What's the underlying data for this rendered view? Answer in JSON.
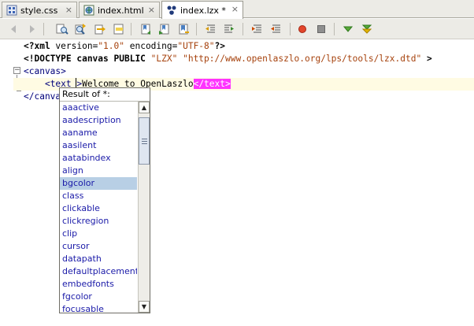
{
  "tabs": [
    {
      "label": "style.css",
      "icon": "css-file-icon",
      "active": false
    },
    {
      "label": "index.html",
      "icon": "html-file-icon",
      "active": false
    },
    {
      "label": "index.lzx *",
      "icon": "lzx-file-icon",
      "active": true
    }
  ],
  "tab_close_glyph": "×",
  "toolbar": {
    "buttons": [
      "back-icon",
      "forward-icon",
      "find-selection-icon",
      "find-previous-icon",
      "find-next-icon",
      "toggle-highlight-icon",
      "previous-bookmark-icon",
      "next-bookmark-icon",
      "toggle-bookmark-icon",
      "shift-left-icon",
      "shift-right-icon",
      "comment-icon",
      "uncomment-icon",
      "start-macro-icon",
      "stop-macro-icon",
      "check-xml-icon",
      "validate-xml-icon"
    ]
  },
  "code": {
    "line1": {
      "a": "<?xml ",
      "b": "version=",
      "c": "\"1.0\"",
      "d": " encoding=",
      "e": "\"UTF-8\"",
      "f": "?>"
    },
    "line2": {
      "a": "<!DOCTYPE canvas PUBLIC ",
      "b": "\"LZX\"",
      "c": " ",
      "d": "\"http://www.openlaszlo.org/lps/tools/lzx.dtd\"",
      "e": " >"
    },
    "line3": "<canvas>",
    "line4": {
      "open": "<text ",
      "gt": ">",
      "content": "Welcome to OpenLaszlo",
      "close": "</text>"
    },
    "line5": "</canva"
  },
  "fold_glyph": "−",
  "completion": {
    "header": "Result of *:",
    "items": [
      "aaactive",
      "aadescription",
      "aaname",
      "aasilent",
      "aatabindex",
      "align",
      "bgcolor",
      "class",
      "clickable",
      "clickregion",
      "clip",
      "cursor",
      "datapath",
      "defaultplacement",
      "embedfonts",
      "fgcolor",
      "focusable"
    ],
    "selected": "bgcolor",
    "scroll_up_glyph": "▲",
    "scroll_down_glyph": "▼"
  },
  "colors": {
    "tag_highlight": "#ff33ff",
    "current_line": "#fffbe3",
    "selection": "#b8cfe5",
    "attribute_text": "#1a1aa8"
  }
}
